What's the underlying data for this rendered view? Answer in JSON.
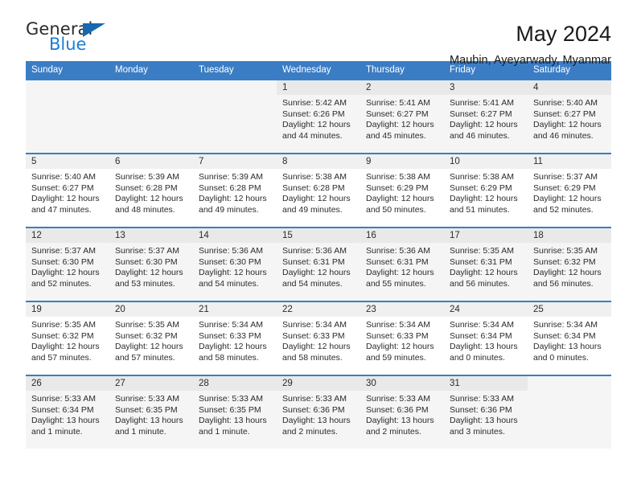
{
  "logo": {
    "line1": "General",
    "line2": "Blue",
    "triangle_icon": "triangle-icon",
    "colors": {
      "text": "#2b2b2b",
      "blue": "#1b7fd4",
      "triangle": "#1668b0"
    }
  },
  "header": {
    "title": "May 2024",
    "subtitle": "Maubin, Ayeyarwady, Myanmar"
  },
  "theme": {
    "header_blue": "#3b7dc4",
    "row_border": "#3b7dc4",
    "daynum_bg": "#f0f0f0",
    "shaded_row_bg": "#f5f5f5"
  },
  "calendar": {
    "weekday_headers": [
      "Sunday",
      "Monday",
      "Tuesday",
      "Wednesday",
      "Thursday",
      "Friday",
      "Saturday"
    ],
    "labels": {
      "sunrise": "Sunrise:",
      "sunset": "Sunset:",
      "daylight": "Daylight:"
    },
    "weeks": [
      {
        "shaded": true,
        "days": [
          {
            "empty": true
          },
          {
            "empty": true
          },
          {
            "empty": true
          },
          {
            "day": "1",
            "sunrise": "Sunrise: 5:42 AM",
            "sunset": "Sunset: 6:26 PM",
            "daylight1": "Daylight: 12 hours",
            "daylight2": "and 44 minutes."
          },
          {
            "day": "2",
            "sunrise": "Sunrise: 5:41 AM",
            "sunset": "Sunset: 6:27 PM",
            "daylight1": "Daylight: 12 hours",
            "daylight2": "and 45 minutes."
          },
          {
            "day": "3",
            "sunrise": "Sunrise: 5:41 AM",
            "sunset": "Sunset: 6:27 PM",
            "daylight1": "Daylight: 12 hours",
            "daylight2": "and 46 minutes."
          },
          {
            "day": "4",
            "sunrise": "Sunrise: 5:40 AM",
            "sunset": "Sunset: 6:27 PM",
            "daylight1": "Daylight: 12 hours",
            "daylight2": "and 46 minutes."
          }
        ]
      },
      {
        "shaded": false,
        "days": [
          {
            "day": "5",
            "sunrise": "Sunrise: 5:40 AM",
            "sunset": "Sunset: 6:27 PM",
            "daylight1": "Daylight: 12 hours",
            "daylight2": "and 47 minutes."
          },
          {
            "day": "6",
            "sunrise": "Sunrise: 5:39 AM",
            "sunset": "Sunset: 6:28 PM",
            "daylight1": "Daylight: 12 hours",
            "daylight2": "and 48 minutes."
          },
          {
            "day": "7",
            "sunrise": "Sunrise: 5:39 AM",
            "sunset": "Sunset: 6:28 PM",
            "daylight1": "Daylight: 12 hours",
            "daylight2": "and 49 minutes."
          },
          {
            "day": "8",
            "sunrise": "Sunrise: 5:38 AM",
            "sunset": "Sunset: 6:28 PM",
            "daylight1": "Daylight: 12 hours",
            "daylight2": "and 49 minutes."
          },
          {
            "day": "9",
            "sunrise": "Sunrise: 5:38 AM",
            "sunset": "Sunset: 6:29 PM",
            "daylight1": "Daylight: 12 hours",
            "daylight2": "and 50 minutes."
          },
          {
            "day": "10",
            "sunrise": "Sunrise: 5:38 AM",
            "sunset": "Sunset: 6:29 PM",
            "daylight1": "Daylight: 12 hours",
            "daylight2": "and 51 minutes."
          },
          {
            "day": "11",
            "sunrise": "Sunrise: 5:37 AM",
            "sunset": "Sunset: 6:29 PM",
            "daylight1": "Daylight: 12 hours",
            "daylight2": "and 52 minutes."
          }
        ]
      },
      {
        "shaded": true,
        "days": [
          {
            "day": "12",
            "sunrise": "Sunrise: 5:37 AM",
            "sunset": "Sunset: 6:30 PM",
            "daylight1": "Daylight: 12 hours",
            "daylight2": "and 52 minutes."
          },
          {
            "day": "13",
            "sunrise": "Sunrise: 5:37 AM",
            "sunset": "Sunset: 6:30 PM",
            "daylight1": "Daylight: 12 hours",
            "daylight2": "and 53 minutes."
          },
          {
            "day": "14",
            "sunrise": "Sunrise: 5:36 AM",
            "sunset": "Sunset: 6:30 PM",
            "daylight1": "Daylight: 12 hours",
            "daylight2": "and 54 minutes."
          },
          {
            "day": "15",
            "sunrise": "Sunrise: 5:36 AM",
            "sunset": "Sunset: 6:31 PM",
            "daylight1": "Daylight: 12 hours",
            "daylight2": "and 54 minutes."
          },
          {
            "day": "16",
            "sunrise": "Sunrise: 5:36 AM",
            "sunset": "Sunset: 6:31 PM",
            "daylight1": "Daylight: 12 hours",
            "daylight2": "and 55 minutes."
          },
          {
            "day": "17",
            "sunrise": "Sunrise: 5:35 AM",
            "sunset": "Sunset: 6:31 PM",
            "daylight1": "Daylight: 12 hours",
            "daylight2": "and 56 minutes."
          },
          {
            "day": "18",
            "sunrise": "Sunrise: 5:35 AM",
            "sunset": "Sunset: 6:32 PM",
            "daylight1": "Daylight: 12 hours",
            "daylight2": "and 56 minutes."
          }
        ]
      },
      {
        "shaded": false,
        "days": [
          {
            "day": "19",
            "sunrise": "Sunrise: 5:35 AM",
            "sunset": "Sunset: 6:32 PM",
            "daylight1": "Daylight: 12 hours",
            "daylight2": "and 57 minutes."
          },
          {
            "day": "20",
            "sunrise": "Sunrise: 5:35 AM",
            "sunset": "Sunset: 6:32 PM",
            "daylight1": "Daylight: 12 hours",
            "daylight2": "and 57 minutes."
          },
          {
            "day": "21",
            "sunrise": "Sunrise: 5:34 AM",
            "sunset": "Sunset: 6:33 PM",
            "daylight1": "Daylight: 12 hours",
            "daylight2": "and 58 minutes."
          },
          {
            "day": "22",
            "sunrise": "Sunrise: 5:34 AM",
            "sunset": "Sunset: 6:33 PM",
            "daylight1": "Daylight: 12 hours",
            "daylight2": "and 58 minutes."
          },
          {
            "day": "23",
            "sunrise": "Sunrise: 5:34 AM",
            "sunset": "Sunset: 6:33 PM",
            "daylight1": "Daylight: 12 hours",
            "daylight2": "and 59 minutes."
          },
          {
            "day": "24",
            "sunrise": "Sunrise: 5:34 AM",
            "sunset": "Sunset: 6:34 PM",
            "daylight1": "Daylight: 13 hours",
            "daylight2": "and 0 minutes."
          },
          {
            "day": "25",
            "sunrise": "Sunrise: 5:34 AM",
            "sunset": "Sunset: 6:34 PM",
            "daylight1": "Daylight: 13 hours",
            "daylight2": "and 0 minutes."
          }
        ]
      },
      {
        "shaded": true,
        "days": [
          {
            "day": "26",
            "sunrise": "Sunrise: 5:33 AM",
            "sunset": "Sunset: 6:34 PM",
            "daylight1": "Daylight: 13 hours",
            "daylight2": "and 1 minute."
          },
          {
            "day": "27",
            "sunrise": "Sunrise: 5:33 AM",
            "sunset": "Sunset: 6:35 PM",
            "daylight1": "Daylight: 13 hours",
            "daylight2": "and 1 minute."
          },
          {
            "day": "28",
            "sunrise": "Sunrise: 5:33 AM",
            "sunset": "Sunset: 6:35 PM",
            "daylight1": "Daylight: 13 hours",
            "daylight2": "and 1 minute."
          },
          {
            "day": "29",
            "sunrise": "Sunrise: 5:33 AM",
            "sunset": "Sunset: 6:36 PM",
            "daylight1": "Daylight: 13 hours",
            "daylight2": "and 2 minutes."
          },
          {
            "day": "30",
            "sunrise": "Sunrise: 5:33 AM",
            "sunset": "Sunset: 6:36 PM",
            "daylight1": "Daylight: 13 hours",
            "daylight2": "and 2 minutes."
          },
          {
            "day": "31",
            "sunrise": "Sunrise: 5:33 AM",
            "sunset": "Sunset: 6:36 PM",
            "daylight1": "Daylight: 13 hours",
            "daylight2": "and 3 minutes."
          },
          {
            "empty": true
          }
        ]
      }
    ]
  }
}
